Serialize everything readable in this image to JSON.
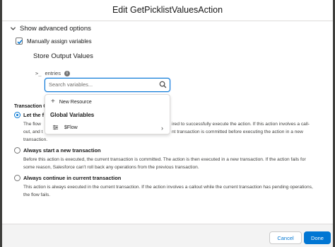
{
  "modal": {
    "title": "Edit GetPicklistValuesAction"
  },
  "advanced": {
    "label": "Show advanced options",
    "manual_assign_label": "Manually assign variables"
  },
  "store_output": {
    "title": "Store Output Values",
    "entries_label": "entries",
    "search": {
      "placeholder": "Search variables..."
    },
    "dropdown": {
      "new_resource": "New Resource",
      "global_heading": "Global Variables",
      "flow_item": "$Flow"
    }
  },
  "transaction": {
    "heading": "Transaction C",
    "options": [
      {
        "title": "Let the f",
        "line1_left": "The flow",
        "line1_right": "ired to successfully execute the action. If this action involves a call-",
        "line2_left": "out, and t",
        "line2_right": "nt transaction is committed before executing the action in a new",
        "line3": "transaction."
      },
      {
        "title": "Always start a new transaction",
        "desc": "Before this action is executed, the current transaction is committed. The action is then executed in a new transaction. If the action fails for some reason, Salesforce can't roll back any operations from the previous transaction."
      },
      {
        "title": "Always continue in current transaction",
        "desc": "This action is always executed in the current transaction. If the action involves a callout while the current transaction has pending operations, the flow fails."
      }
    ]
  },
  "footer": {
    "cancel_label": "Cancel",
    "done_label": "Done"
  },
  "colors": {
    "brand": "#0176d3",
    "border": "#dddbda",
    "footer_bg": "#f3f3f3"
  }
}
